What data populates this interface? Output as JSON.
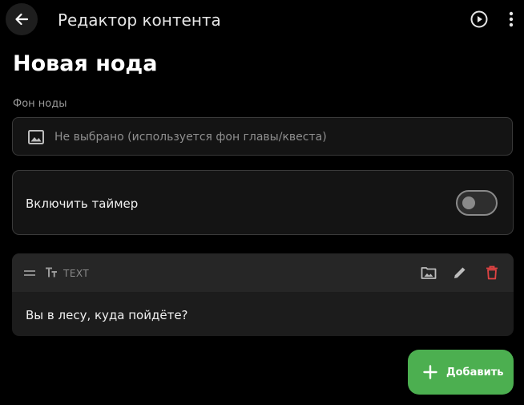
{
  "topbar": {
    "title": "Редактор контента",
    "back_icon": "arrow-left-icon",
    "play_icon": "play-circle-icon",
    "more_icon": "more-vert-icon"
  },
  "page": {
    "title": "Новая нода"
  },
  "background_field": {
    "label": "Фон ноды",
    "value": "Не выбрано (используется фон главы/квеста)",
    "icon": "image-icon"
  },
  "timer": {
    "label": "Включить таймер",
    "enabled": false
  },
  "content_block": {
    "type_label": "TEXT",
    "type_icon": "text-fields-icon",
    "text": "Вы в лесу, куда пойдёте?",
    "actions": [
      "image-select-icon",
      "edit-icon",
      "delete-icon"
    ]
  },
  "fab": {
    "label": "Добавить",
    "icon": "plus-icon"
  },
  "colors": {
    "background": "#000000",
    "card": "#141414",
    "accent": "#4caf50",
    "delete": "#e04343"
  }
}
